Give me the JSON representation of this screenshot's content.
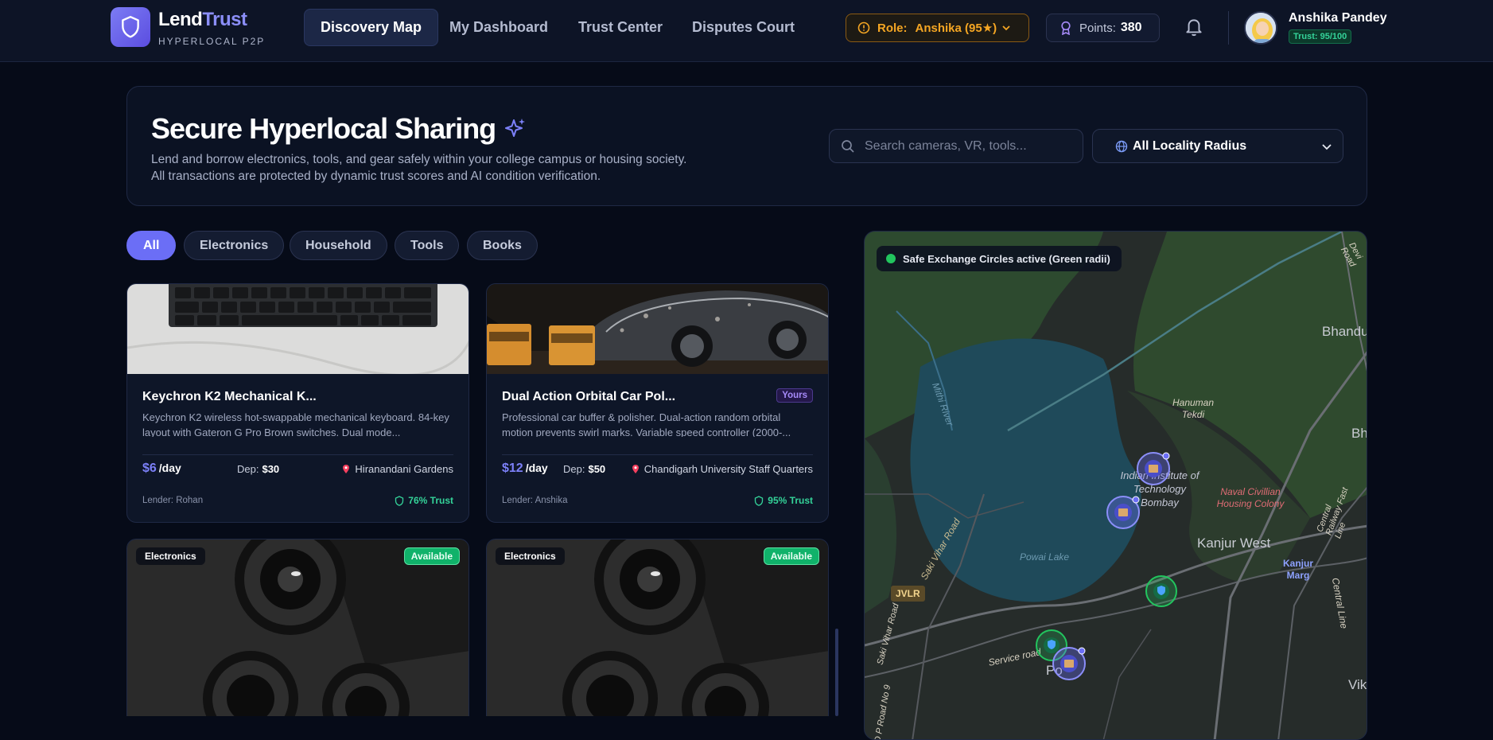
{
  "brand": {
    "name_main": "Lend",
    "name_accent": "Trust",
    "subtitle": "HYPERLOCAL P2P"
  },
  "nav": [
    {
      "label": "Discovery Map",
      "active": true
    },
    {
      "label": "My Dashboard",
      "active": false
    },
    {
      "label": "Trust Center",
      "active": false
    },
    {
      "label": "Disputes Court",
      "active": false
    }
  ],
  "role": {
    "label": "Role:",
    "value": "Anshika (95★)"
  },
  "points": {
    "label": "Points:",
    "value": "380"
  },
  "user": {
    "name": "Anshika Pandey",
    "trust": "Trust: 95/100"
  },
  "hero": {
    "title": "Secure Hyperlocal Sharing",
    "desc_1": "Lend and borrow electronics, tools, and gear safely within your college campus or housing society.",
    "desc_2": "All transactions are protected by dynamic trust scores and AI condition verification."
  },
  "search": {
    "placeholder": "Search cameras, VR, tools..."
  },
  "radius": {
    "value": "All Locality Radius"
  },
  "filters": [
    "All",
    "Electronics",
    "Household",
    "Tools",
    "Books"
  ],
  "listings": [
    {
      "title": "Keychron K2 Mechanical K...",
      "desc": "Keychron K2 wireless hot-swappable mechanical keyboard. 84-key layout with Gateron G Pro Brown switches. Dual mode...",
      "price": "$6",
      "per": "/day",
      "dep_label": "Dep:",
      "deposit": "$30",
      "location": "Hiranandani Gardens",
      "lender": "Lender: Rohan",
      "trust": "76% Trust"
    },
    {
      "title": "Dual Action Orbital Car Pol...",
      "badge": "Yours",
      "desc": "Professional car buffer & polisher. Dual-action random orbital motion prevents swirl marks. Variable speed controller (2000-...",
      "price": "$12",
      "per": "/day",
      "dep_label": "Dep:",
      "deposit": "$50",
      "location": "Chandigarh University Staff Quarters",
      "lender": "Lender: Anshika",
      "trust": "95% Trust"
    },
    {
      "category": "Electronics",
      "status": "Available"
    },
    {
      "category": "Electronics",
      "status": "Available"
    }
  ],
  "map": {
    "badge": "Safe Exchange Circles active (Green radii)",
    "labels": [
      "Bhandu",
      "Bh",
      "Hanuman Tekdi",
      "Indian Institute of Technology Bombay",
      "Naval Civillian Housing Colony",
      "Kanjur West",
      "Kanjur Marg",
      "Powai Lake",
      "Saki Vihar Road",
      "JVLR",
      "Service road",
      "Mithi River",
      "Vik",
      "Central Line",
      "Central Railway Fast Line",
      "Devi Road",
      "D P Road No 9",
      "Saki Vihar Road",
      "Po"
    ]
  },
  "colors": {
    "accent": "#6b6ef6",
    "trust_green": "#34d399",
    "role_orange": "#f5a623",
    "bg": "#060b18"
  }
}
